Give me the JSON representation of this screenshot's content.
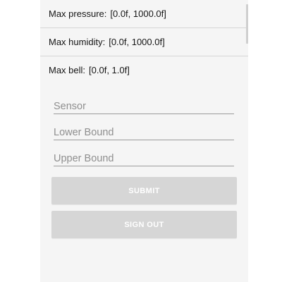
{
  "ranges": [
    {
      "label": "Max pressure:",
      "value": "[0.0f, 1000.0f]"
    },
    {
      "label": "Max humidity:",
      "value": "[0.0f, 1000.0f]"
    },
    {
      "label": "Max bell:",
      "value": "[0.0f, 1.0f]"
    }
  ],
  "form": {
    "sensor_placeholder": "Sensor",
    "lower_placeholder": "Lower Bound",
    "upper_placeholder": "Upper Bound",
    "submit_label": "SUBMIT",
    "signout_label": "SIGN OUT"
  },
  "colors": {
    "background": "#f5f5f5",
    "button": "#d6d6d6",
    "button_text": "#ffffff",
    "hint_text": "#8f8f8f"
  }
}
